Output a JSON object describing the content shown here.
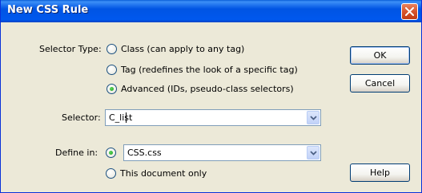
{
  "window": {
    "title": "New CSS Rule"
  },
  "selector_type": {
    "label": "Selector Type:",
    "options": [
      {
        "label": "Class (can apply to any tag)",
        "checked": false
      },
      {
        "label": "Tag (redefines the look of a specific tag)",
        "checked": false
      },
      {
        "label": "Advanced (IDs, pseudo-class selectors)",
        "checked": true
      }
    ]
  },
  "selector": {
    "label": "Selector:",
    "value": "C_list"
  },
  "define_in": {
    "label": "Define in:",
    "file_value": "CSS.css",
    "this_document_label": "This document only",
    "file_checked": true,
    "this_document_checked": false
  },
  "buttons": {
    "ok": "OK",
    "cancel": "Cancel",
    "help": "Help"
  },
  "icons": {
    "close": "close-icon",
    "dropdown": "chevron-down-icon"
  },
  "colors": {
    "titlebar": "#0054e3",
    "close": "#d8542d",
    "dialog_bg": "#ece9d8",
    "radio_dot": "#21a121"
  }
}
